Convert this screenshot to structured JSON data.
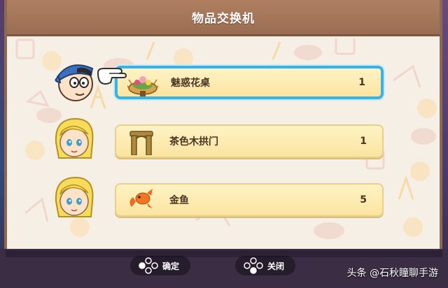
{
  "window": {
    "title": "物品交换机"
  },
  "items": [
    {
      "name": "魅惑花桌",
      "qty": "1",
      "icon": "flower-table-icon",
      "selected": true
    },
    {
      "name": "茶色木拱门",
      "qty": "1",
      "icon": "wooden-arch-icon",
      "selected": false
    },
    {
      "name": "金鱼",
      "qty": "5",
      "icon": "goldfish-icon",
      "selected": false
    }
  ],
  "buttons": {
    "confirm": "确定",
    "close": "关闭"
  },
  "watermark": "头条 @石秋瞳聊手游",
  "colors": {
    "title_bar": "#a87659",
    "panel": "#f6efe6",
    "row": "#fbe8a8",
    "selection": "#39b2e8",
    "text": "#4a3424"
  }
}
